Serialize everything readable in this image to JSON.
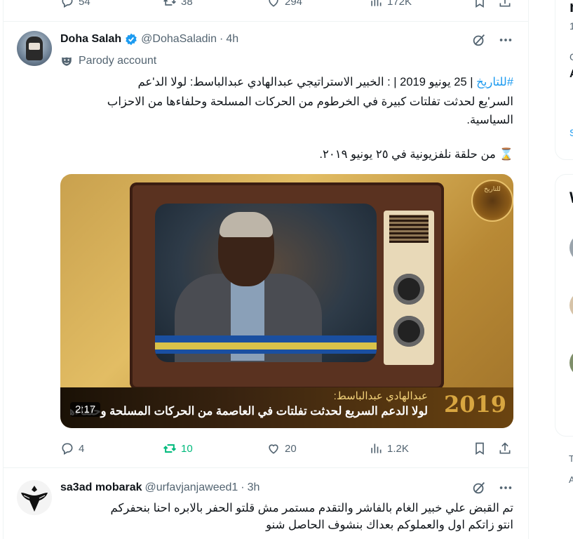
{
  "prev_tweet": {
    "reply_count": "54",
    "retweet_count": "38",
    "like_count": "294",
    "view_count": "172K"
  },
  "tweet": {
    "display_name": "Doha Salah",
    "handle": "@DohaSaladin",
    "separator": "·",
    "time": "4h",
    "label": "Parody account",
    "hashtag": "#للتاريخ",
    "text_line1": "| 25 يونيو 2019 | : الخبير الاستراتيجي عبدالهادي عبدالباسط: لولا الد'عم",
    "text_line2": "السر'يع لحدثت تفلتات كبيرة في الخرطوم من الحركات المسلحة وحلفاءها من الاحزاب",
    "text_line3": "السياسية.",
    "text_line4": "⌛ من حلقة نلفزيونية في ٢٥ يونيو ٢٠١٩.",
    "media": {
      "banner_title": "عبدالهادي عبدالباسط:",
      "banner_sub": "لولا الدعم السريع لحدثت تفلتات في العاصمة من الحركات المسلحة وحلفاءهم من الاحزاب",
      "year": "2019",
      "duration": "2:17",
      "logo_text": "للتاريخ"
    },
    "reply_count": "4",
    "retweet_count": "10",
    "like_count": "20",
    "view_count": "1.2K",
    "colors": {
      "retweet_active": "#00ba7c",
      "verified": "#1d9bf0"
    }
  },
  "next_tweet": {
    "display_name": "sa3ad mobarak",
    "handle": "@urfavjanjaweed1",
    "separator": "·",
    "time": "3h",
    "text_line1": "تم القبض علي خبير الغام بالفاشر والتقدم مستمر مش قلتو الحفر بالابره احنا بنحفركم",
    "text_line2": "انتو زاتكم اول والعملوكم بعداك بنشوف الحاصل شنو"
  },
  "right_column": {
    "fragments": [
      "n",
      "1",
      "G",
      "A",
      "S",
      "W",
      "T",
      "A"
    ]
  }
}
